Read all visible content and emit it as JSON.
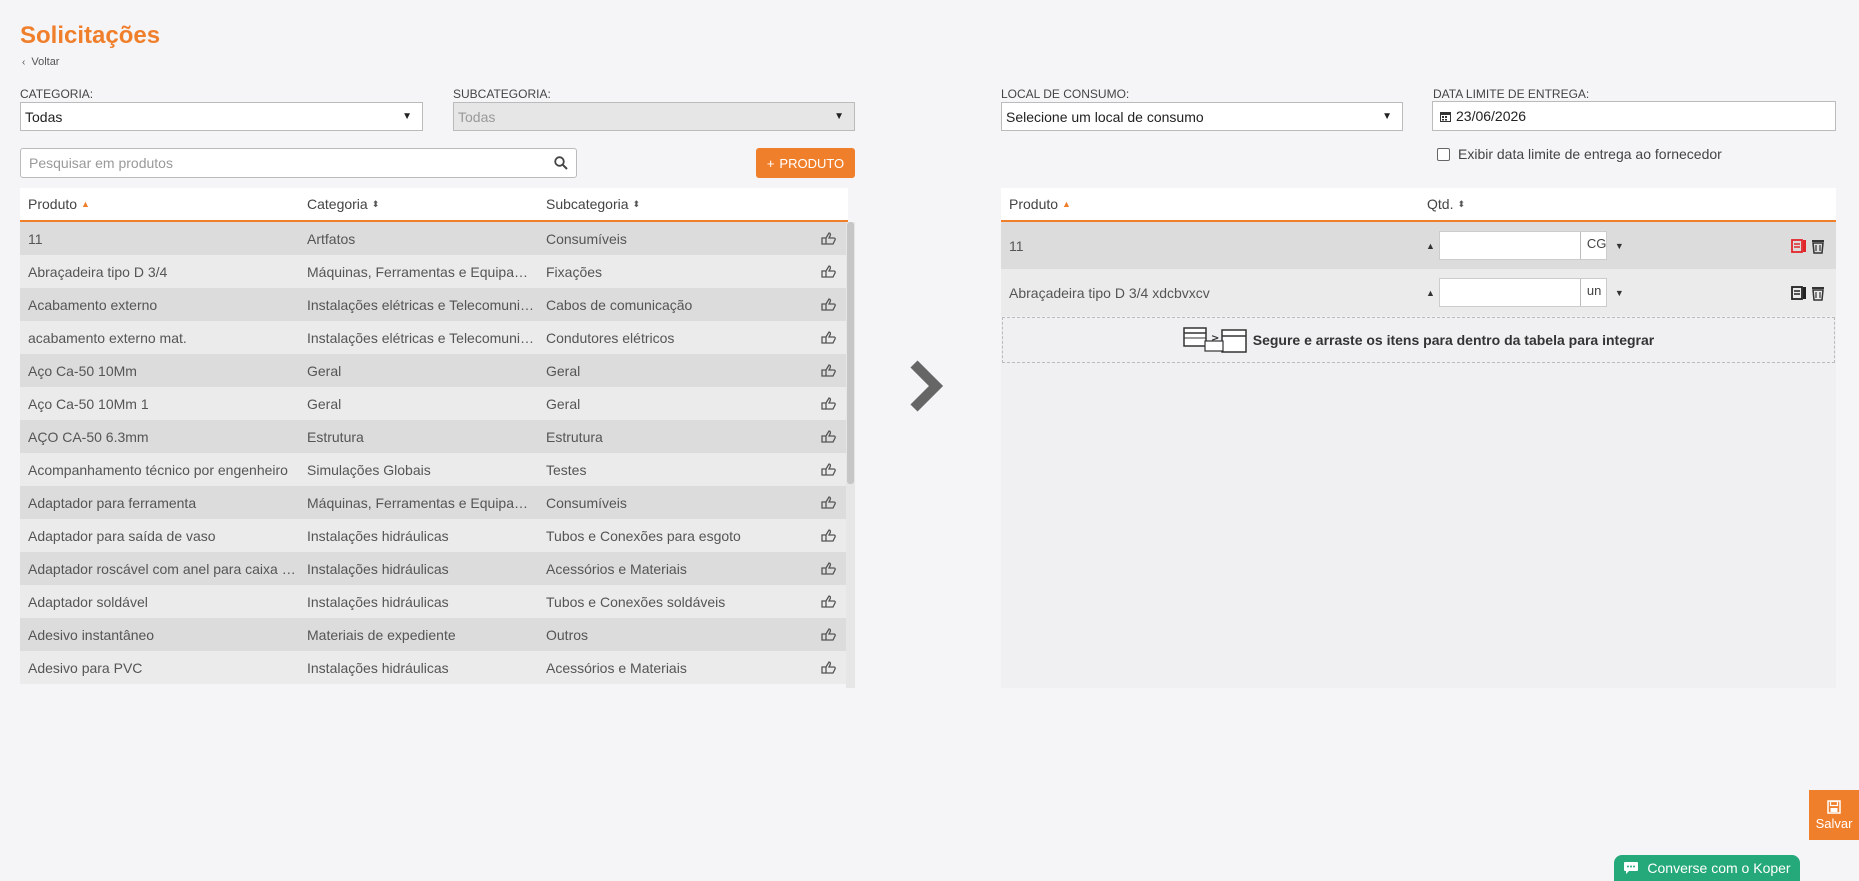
{
  "page": {
    "title": "Solicitações",
    "back_label": "Voltar"
  },
  "filters": {
    "categoria_label": "CATEGORIA:",
    "categoria_value": "Todas",
    "subcategoria_label": "SUBCATEGORIA:",
    "subcategoria_value": "Todas",
    "search_placeholder": "Pesquisar em produtos",
    "add_button_label": "PRODUTO"
  },
  "products_table": {
    "headers": [
      "Produto",
      "Categoria",
      "Subcategoria"
    ],
    "rows": [
      [
        "11",
        "Artfatos",
        "Consumíveis"
      ],
      [
        "Abraçadeira tipo D 3/4",
        "Máquinas, Ferramentas e Equipamentos",
        "Fixações"
      ],
      [
        "Acabamento externo",
        "Instalações elétricas e Telecomunicações",
        "Cabos de comunicação"
      ],
      [
        "acabamento externo mat.",
        "Instalações elétricas e Telecomunicações",
        "Condutores elétricos"
      ],
      [
        "Aço Ca-50 10Mm",
        "Geral",
        "Geral"
      ],
      [
        "Aço Ca-50 10Mm 1",
        "Geral",
        "Geral"
      ],
      [
        "AÇO CA-50 6.3mm",
        "Estrutura",
        "Estrutura"
      ],
      [
        "Acompanhamento técnico por engenheiro",
        "Simulações Globais",
        "Testes"
      ],
      [
        "Adaptador para ferramenta",
        "Máquinas, Ferramentas e Equipamentos",
        "Consumíveis"
      ],
      [
        "Adaptador para saída de vaso",
        "Instalações hidráulicas",
        "Tubos e Conexões para esgoto"
      ],
      [
        "Adaptador roscável com anel para caixa d'água",
        "Instalações hidráulicas",
        "Acessórios e Materiais"
      ],
      [
        "Adaptador soldável",
        "Instalações hidráulicas",
        "Tubos e Conexões soldáveis"
      ],
      [
        "Adesivo instantâneo",
        "Materiais de expediente",
        "Outros"
      ],
      [
        "Adesivo para PVC",
        "Instalações hidráulicas",
        "Acessórios e Materiais"
      ]
    ]
  },
  "request": {
    "local_label": "LOCAL DE CONSUMO:",
    "local_value": "Selecione um local de consumo",
    "date_label": "DATA LIMITE DE ENTREGA:",
    "date_value": "23/06/2026",
    "show_date_label": "Exibir data limite de entrega ao fornecedor",
    "headers": [
      "Produto",
      "Qtd."
    ],
    "items": [
      {
        "name": "11",
        "qty": "",
        "unit": "CG"
      },
      {
        "name": "Abraçadeira tipo D 3/4 xdcbvxcv",
        "qty": "",
        "unit": "un"
      }
    ],
    "drop_hint": "Segure e arraste os itens para dentro da tabela para integrar"
  },
  "actions": {
    "save_label": "Salvar",
    "chat_label": "Converse com o Koper"
  },
  "colors": {
    "accent": "#f07f2c",
    "chat": "#25a97a",
    "danger": "#e0262b"
  }
}
